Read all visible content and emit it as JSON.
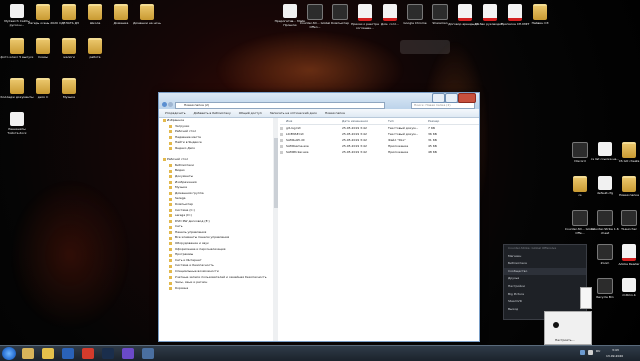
{
  "desktop": {
    "top_left_icons": [
      {
        "label": "MyCsarch Сайты pycoo.н...",
        "kind": "doc"
      },
      {
        "label": "Лагерь осень 2020",
        "kind": "folder"
      },
      {
        "label": "СДЕЛАТЬ ДЗ",
        "kind": "folder"
      },
      {
        "label": "Школа",
        "kind": "folder"
      },
      {
        "label": "Домашка",
        "kind": "folder"
      },
      {
        "label": "Домашки на ночь",
        "kind": "folder"
      },
      {
        "label": "фото класс 5 выпуск",
        "kind": "folder"
      },
      {
        "label": "Сказы",
        "kind": "folder"
      },
      {
        "label": "жалоги",
        "kind": "folder"
      },
      {
        "label": "работа",
        "kind": "folder"
      },
      {
        "label": "Колледж документы",
        "kind": "folder"
      },
      {
        "label": "диск C",
        "kind": "folder"
      },
      {
        "label": "Музыка",
        "kind": "folder"
      },
      {
        "label": "Раннанаты Тойота.docx",
        "kind": "doc"
      }
    ],
    "top_right_icons": [
      {
        "label": "Прерогатив... Майк Прошлю",
        "kind": "doc"
      },
      {
        "label": "Counter-Str... Global Offen...",
        "kind": "exe"
      },
      {
        "label": "Компьютер",
        "kind": "exe"
      },
      {
        "label": "Приказ о реестре соглашен...",
        "kind": "pdf"
      },
      {
        "label": "Дом. согл...",
        "kind": "pdf"
      },
      {
        "label": "Google Chrome",
        "kind": "exe"
      },
      {
        "label": "Shareman",
        "kind": "exe"
      },
      {
        "label": "Договор аренды кв...",
        "kind": "pdf"
      },
      {
        "label": "ДЗ Зак руководит...",
        "kind": "pdf"
      },
      {
        "label": "Прописка СП-МФТ",
        "kind": "pdf"
      },
      {
        "label": "Пайвин СЭ",
        "kind": "folder"
      }
    ],
    "right_column_icons": [
      {
        "label": "Discord",
        "kind": "exe"
      },
      {
        "label": "cs list ссылка на...",
        "kind": "doc"
      },
      {
        "label": "CS GO cheats",
        "kind": "folder"
      },
      {
        "label": "cs",
        "kind": "folder"
      },
      {
        "label": "default.cfg",
        "kind": "doc"
      },
      {
        "label": "Новая папка",
        "kind": "folder"
      },
      {
        "label": "Counter-Str... Global Offe...",
        "kind": "exe"
      },
      {
        "label": "Counter-Strike 1.6 cheat",
        "kind": "exe"
      },
      {
        "label": "TLauncher",
        "kind": "exe"
      },
      {
        "label": "Zoom",
        "kind": "exe"
      },
      {
        "label": "Adobe Reader",
        "kind": "pdf"
      },
      {
        "label": "Recycle Bin",
        "kind": "exe"
      },
      {
        "label": "m2b1n.b",
        "kind": "doc"
      }
    ]
  },
  "explorer": {
    "address": "Новая папка (2)",
    "search_placeholder": "Поиск: Новая папка (2)",
    "toolbar": [
      "Упорядочить",
      "Добавить в библиотеку",
      "Общий доступ",
      "Записать на оптический диск",
      "Новая папка"
    ],
    "nav_items": [
      {
        "label": "Избранное",
        "level": 1
      },
      {
        "label": "Загрузки",
        "level": 2
      },
      {
        "label": "Рабочий стол",
        "level": 2
      },
      {
        "label": "Недавние места",
        "level": 2
      },
      {
        "label": "Найти в Яндексе",
        "level": 2
      },
      {
        "label": "Яндекс.Диск",
        "level": 2
      },
      {
        "label": "",
        "level": 1
      },
      {
        "label": "Рабочий стол",
        "level": 1
      },
      {
        "label": "Библиотеки",
        "level": 2
      },
      {
        "label": "Видео",
        "level": 2
      },
      {
        "label": "Документы",
        "level": 2
      },
      {
        "label": "Изображения",
        "level": 2
      },
      {
        "label": "Музыка",
        "level": 2
      },
      {
        "label": "Домашняя группа",
        "level": 2
      },
      {
        "label": "Serega",
        "level": 2
      },
      {
        "label": "Компьютер",
        "level": 2
      },
      {
        "label": "Система (C:)",
        "level": 2
      },
      {
        "label": "serega (D:)",
        "level": 2
      },
      {
        "label": "DVD RW дисковод (E:)",
        "level": 2
      },
      {
        "label": "Сеть",
        "level": 2
      },
      {
        "label": "Панель управления",
        "level": 2
      },
      {
        "label": "Все элементы панели управления",
        "level": 2
      },
      {
        "label": "Оборудование и звук",
        "level": 2
      },
      {
        "label": "Оформление и персонализация",
        "level": 2
      },
      {
        "label": "Программы",
        "level": 2
      },
      {
        "label": "Сеть и Интернет",
        "level": 2
      },
      {
        "label": "Система и безопасность",
        "level": 2
      },
      {
        "label": "Специальные возможности",
        "level": 2
      },
      {
        "label": "Учетные записи пользователей и семейная безопасность",
        "level": 2
      },
      {
        "label": "Часы, язык и регион",
        "level": 2
      },
      {
        "label": "Корзина",
        "level": 2
      }
    ],
    "columns": [
      "Имя",
      "Дата изменения",
      "Тип",
      "Размер"
    ],
    "files": [
      {
        "name": "git-log.txt",
        "date": "25.05.2019 3:42",
        "type": "Текстовый докум...",
        "size": "7 КБ"
      },
      {
        "name": "LICENSE.txt",
        "date": "25.05.2019 3:42",
        "type": "Текстовый докум...",
        "size": "36 КБ"
      },
      {
        "name": "SAMILAPI.dll",
        "date": "25.05.2019 3:42",
        "type": "Файл \"DLL\"",
        "size": "31 КБ"
      },
      {
        "name": "SAMIGame.exe",
        "date": "25.05.2019 3:42",
        "type": "Приложение",
        "size": "45 КБ"
      },
      {
        "name": "SAMIPicker.exe",
        "date": "25.05.2019 3:42",
        "type": "Приложение",
        "size": "48 КБ"
      }
    ]
  },
  "steam_menu": {
    "items": [
      {
        "label": "Counter-Strike: Global Offensive",
        "style": "header"
      },
      {
        "label": "Магазин",
        "style": "normal"
      },
      {
        "label": "Библиотека",
        "style": "normal"
      },
      {
        "label": "Сообщество",
        "style": "selected"
      },
      {
        "label": "Друзья",
        "style": "normal"
      },
      {
        "label": "Настройки",
        "style": "normal"
      },
      {
        "label": "Big Picture",
        "style": "normal"
      },
      {
        "label": "SteamVR",
        "style": "normal"
      },
      {
        "label": "Выход",
        "style": "normal"
      }
    ]
  },
  "notification": {
    "button_label": "Настроить..."
  },
  "taskbar": {
    "lang": "RU",
    "time": "3:43",
    "date": "13.09.2020",
    "apps": [
      {
        "name": "explorer-task",
        "color": "#d8b45a"
      },
      {
        "name": "chrome-task",
        "color": "#e5c14b"
      },
      {
        "name": "media-task",
        "color": "#2a62b8"
      },
      {
        "name": "yandex-task",
        "color": "#d33b2c"
      },
      {
        "name": "steam-task",
        "color": "#1a2e4c"
      },
      {
        "name": "discord-task",
        "color": "#6b4ac8"
      },
      {
        "name": "active-task",
        "color": "#4a6fa0"
      }
    ]
  },
  "colors": {
    "accent_orange": "#e8732b",
    "titlebar": "#bcd3ea"
  }
}
